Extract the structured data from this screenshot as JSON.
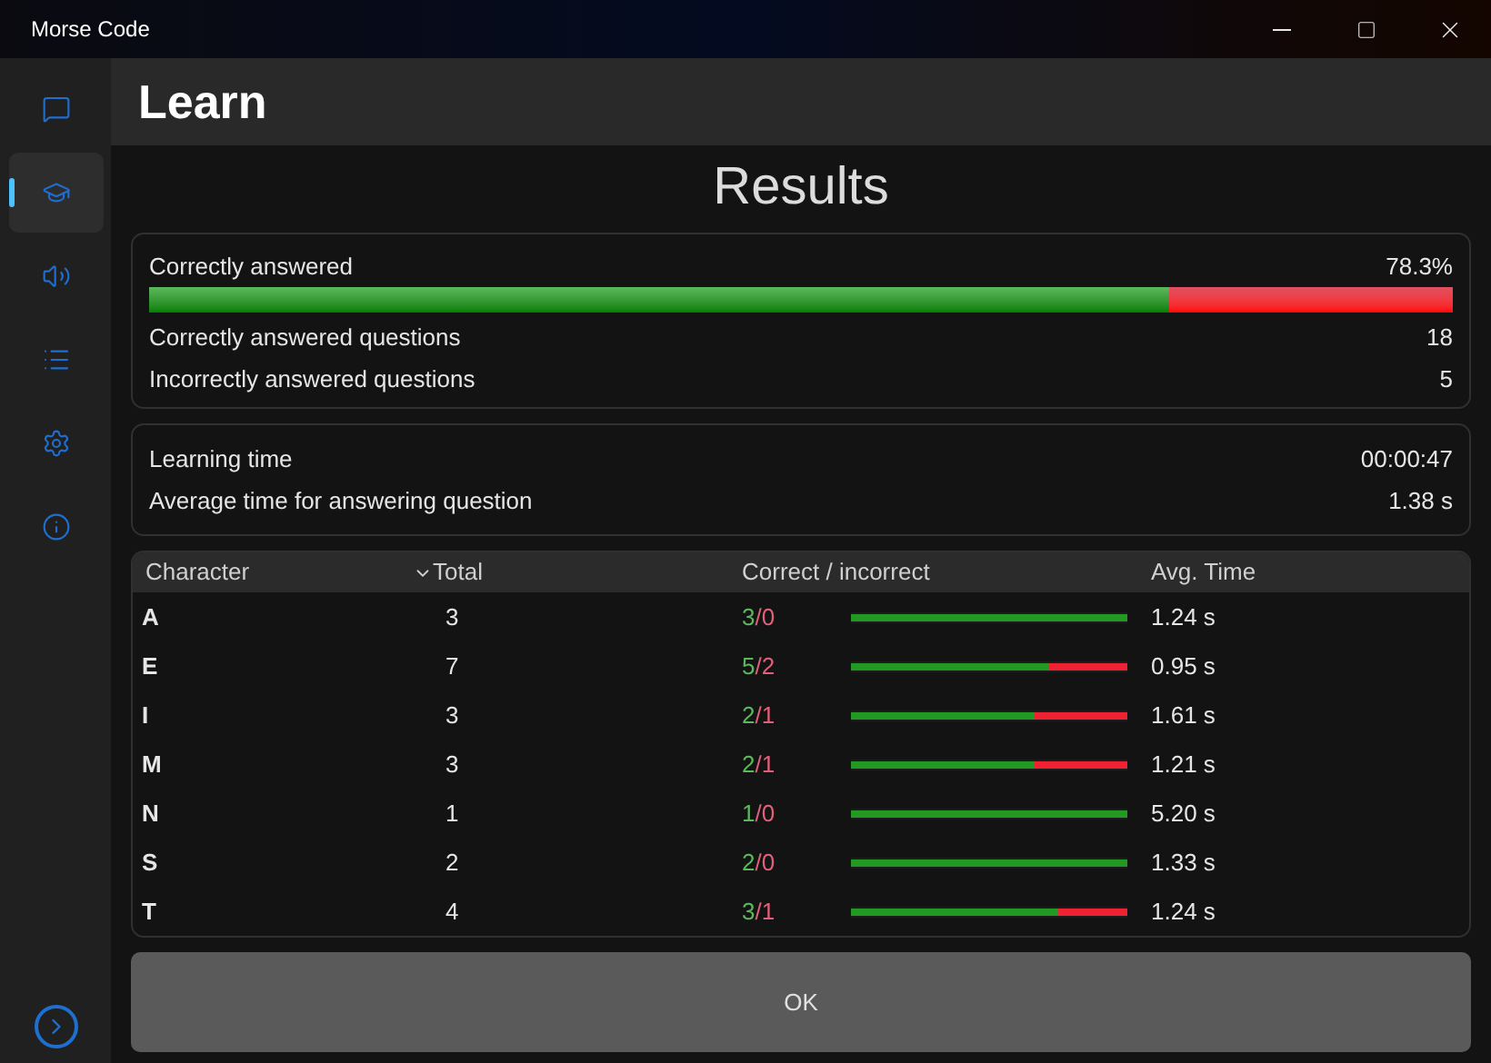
{
  "window": {
    "title": "Morse Code"
  },
  "sidebar": {
    "items": [
      {
        "selected": false
      },
      {
        "selected": true
      },
      {
        "selected": false
      },
      {
        "selected": false
      },
      {
        "selected": false
      },
      {
        "selected": false
      }
    ]
  },
  "header": {
    "title": "Learn"
  },
  "results": {
    "title": "Results",
    "summary": {
      "label": "Correctly answered",
      "value": "78.3%",
      "level": 0.783,
      "rows": [
        {
          "label": "Correctly answered questions",
          "value": "18"
        },
        {
          "label": "Incorrectly answered questions",
          "value": "5"
        }
      ]
    },
    "times": [
      {
        "label": "Learning time",
        "value": "00:00:47"
      },
      {
        "label": "Average time for answering question",
        "value": "1.38 s"
      }
    ]
  },
  "table": {
    "columns": [
      {
        "label": "Character",
        "sorted": false
      },
      {
        "label": "Total",
        "sorted": true
      },
      {
        "label": "Correct / incorrect",
        "sorted": false
      },
      {
        "label": "Avg. Time",
        "sorted": false
      }
    ],
    "rows": [
      {
        "character": "A",
        "total": "3",
        "correct": "3",
        "separator": "/",
        "incorrect": "0",
        "level": 1,
        "avg_time": "1.24 s"
      },
      {
        "character": "E",
        "total": "7",
        "correct": "5",
        "separator": "/",
        "incorrect": "2",
        "level": 0.714,
        "avg_time": "0.95 s"
      },
      {
        "character": "I",
        "total": "3",
        "correct": "2",
        "separator": "/",
        "incorrect": "1",
        "level": 0.667,
        "avg_time": "1.61 s"
      },
      {
        "character": "M",
        "total": "3",
        "correct": "2",
        "separator": "/",
        "incorrect": "1",
        "level": 0.667,
        "avg_time": "1.21 s"
      },
      {
        "character": "N",
        "total": "1",
        "correct": "1",
        "separator": "/",
        "incorrect": "0",
        "level": 1,
        "avg_time": "5.20 s"
      },
      {
        "character": "S",
        "total": "2",
        "correct": "2",
        "separator": "/",
        "incorrect": "0",
        "level": 1,
        "avg_time": "1.33 s"
      },
      {
        "character": "T",
        "total": "4",
        "correct": "3",
        "separator": "/",
        "incorrect": "1",
        "level": 0.75,
        "avg_time": "1.24 s"
      }
    ]
  },
  "button": {
    "label": "OK"
  }
}
